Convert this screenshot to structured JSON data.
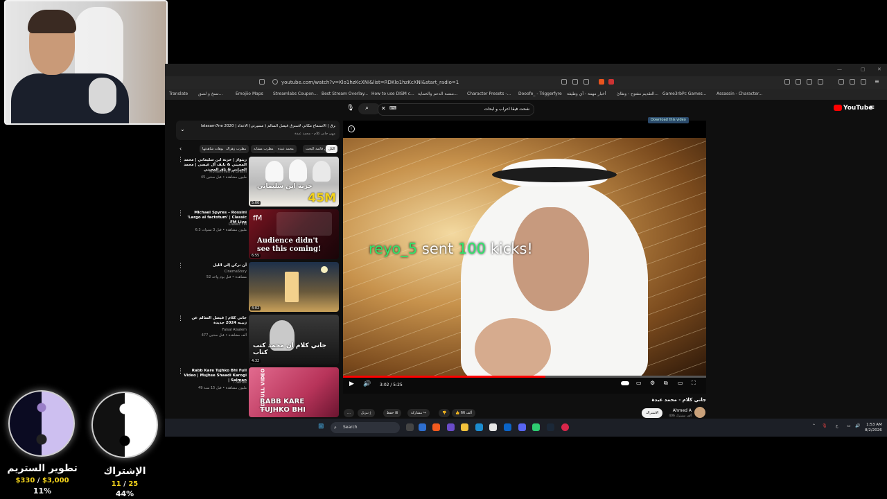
{
  "browser": {
    "url": "youtube.com/watch?v=Klo1hzKcXNI&list=RDKlo1hzKcXNI&start_radio=1",
    "bookmarks": [
      "Translate",
      "نسخ و لصق...",
      "Emojiio",
      "Maps",
      "Streamlabs Coupon...",
      "Best Stream Overlay...",
      "How to use DISM c...",
      "منصة الدعم والحماية...",
      "Character Presets -...",
      "Dooofe_ - Triggerfyre",
      "أخبار مهمة - أي وظيفة",
      "التقديم مفتوح - وظائ...",
      "Game3rbPc Games...",
      "Assassin - Character..."
    ]
  },
  "youtube": {
    "logo": "YouTube",
    "search_text": "شحت فيقا اعراب و ابحاث",
    "download_label": "Download this video",
    "playlist": {
      "title": "lalasam7ne 2020 | النوادي إلاسترق | الاستماع مكاتي لاسترق فيصل السالم ( مسيرتي) الاعداد",
      "subtitle": "مهى جانى كلام - محمد عبدة"
    },
    "chips": [
      "الكل",
      "من قائمة البحث",
      "محمد عبده",
      "مطرب مشابه",
      "مطرب زهراك",
      "فيديوهات شاهدتها"
    ],
    "videos": [
      {
        "title": "ريتواز | خزنة ابن سليماني | محمد المجيني & نايف آل عيسى | محمد الحرابي & ناق المجيني",
        "channel": "Mohammed Al Drashi",
        "meta": "45 مليون مشاهدة • قبل سنتين",
        "duration": "5:00",
        "overlay": "خزنة ابن سليماني",
        "badge": "45M"
      },
      {
        "title": "Michael Spyres – Rossini 'Largo al factotum' | Classic FM Live",
        "channel": "Classic FM",
        "meta": "6.3 مليون مشاهدة • قبل 3 سنوات",
        "duration": "6:55",
        "overlay": "Audience didn't see this coming!",
        "badge": ""
      },
      {
        "title": "أن نركن إلى الليل",
        "channel": "CinemaStory",
        "meta": "52 مشاهدة • قبل يوم واحد",
        "duration": "4:02",
        "overlay": "",
        "badge": ""
      },
      {
        "title": "جاني كلام | فيصل السالم عن زبيبه 2024 جديدة",
        "channel": "Faisal Alsalem",
        "meta": "477 ألف مشاهدة • قبل سنتين",
        "duration": "4:32",
        "overlay": "جاني كلام ان محمد كتب كتاب",
        "badge": ""
      },
      {
        "title": "Rabb Kare Tujhko Bhi Full Video | Mujhse Shaadi Karogi | Salman",
        "channel": "T-Series",
        "meta": "49 مليون مشاهدة • قبل 15 سنة",
        "duration": "",
        "overlay": "RABB KARE TUJHKO BHI",
        "badge": "HD FULL VIDEO"
      }
    ],
    "player": {
      "time": "3:02 / 5:25",
      "progress_fraction": 0.557,
      "alert_user": "reyo_5",
      "alert_mid": " sent ",
      "alert_amount": "100",
      "alert_tail": " kicks!"
    },
    "video_title": "جاني كلام - محمد عبدة",
    "channel_name": "Ahmed A",
    "channel_subs": "406 ألف مشترك",
    "subscribe_label": "الاشتراك",
    "actions": {
      "like": "66 ألف",
      "share": "مشاركة",
      "save": "حفظ",
      "download": "تنزيل"
    }
  },
  "taskbar": {
    "search_label": "Search",
    "time": "1:53 AM",
    "date": "8/2/2026"
  },
  "widgets": {
    "goal_left": {
      "label": "تطوير الستريم",
      "current": "$330",
      "separator": "/",
      "target": "$3,000",
      "percent": "11%",
      "progress_fraction": 0.11
    },
    "goal_right": {
      "label": "الإشتراك",
      "current": "11",
      "separator": "/",
      "target": "25",
      "percent": "44%",
      "progress_fraction": 0.44
    }
  },
  "colors": {
    "youtube_red": "#ff0000",
    "alert_green": "#2ee66b",
    "goal_yellow": "#f3d31b"
  }
}
